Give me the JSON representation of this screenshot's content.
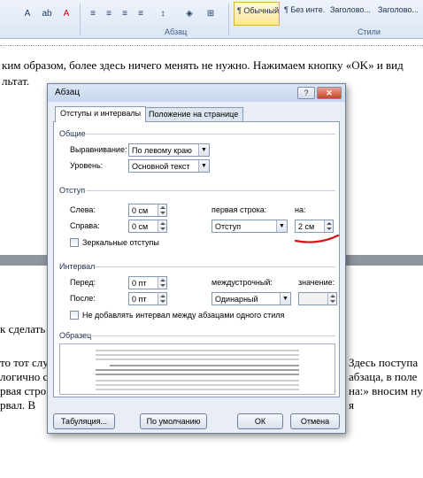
{
  "ribbon": {
    "font_buttons": [
      "A",
      "ab",
      "A"
    ],
    "align_buttons": [
      "≡",
      "≡",
      "≡",
      "≡"
    ],
    "group_paragraph": "Абзац",
    "group_styles": "Стили",
    "styles": [
      "¶ Обычный",
      "¶ Без инте...",
      "Заголово...",
      "Заголово..."
    ]
  },
  "document": {
    "line1": "ким образом, более здесь ничего менять не нужно. Нажимаем кнопку «OK» и вид",
    "line2": "льтат.",
    "line3": "к сделать",
    "line4a": "то тот слу",
    "line4b": "Здесь поступа",
    "line5a": "логично с",
    "line5b": "абзаца, в поле",
    "line6a": "рвая стро",
    "line6b": "на:» вносим ну",
    "line7a": "рвал. В",
    "line7b": "я"
  },
  "dialog": {
    "title": "Абзац",
    "help_button": "?",
    "close_button": "✕",
    "tabs": [
      "Отступы и интервалы",
      "Положение на странице"
    ],
    "sections": {
      "general": "Общие",
      "indent": "Отступ",
      "interval": "Интервал",
      "sample": "Образец"
    },
    "general": {
      "alignment_label": "Выравнивание:",
      "alignment_value": "По левому краю",
      "level_label": "Уровень:",
      "level_value": "Основной текст"
    },
    "indent": {
      "left_label": "Слева:",
      "left_value": "0 см",
      "right_label": "Справа:",
      "right_value": "0 см",
      "first_line_label": "первая строка:",
      "first_line_value": "Отступ",
      "by_label": "на:",
      "by_value": "2 см",
      "mirror_label": "Зеркальные отступы"
    },
    "interval": {
      "before_label": "Перед:",
      "before_value": "0 пт",
      "after_label": "После:",
      "after_value": "0 пт",
      "line_spacing_label": "междустрочный:",
      "line_spacing_value": "Одинарный",
      "value_label": "значение:",
      "value_value": "",
      "no_space_label": "Не добавлять интервал между абзацами одного стиля"
    },
    "buttons": {
      "tabs": "Табуляция...",
      "default": "По умолчанию",
      "ok": "ОК",
      "cancel": "Отмена"
    },
    "colors": {
      "annotation": "#d8121b"
    }
  }
}
